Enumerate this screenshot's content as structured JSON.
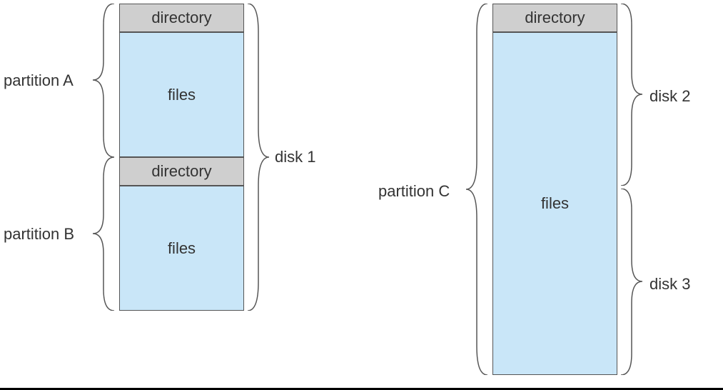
{
  "left": {
    "partA": {
      "label": "partition A",
      "dir": "directory",
      "files": "files"
    },
    "partB": {
      "label": "partition B",
      "dir": "directory",
      "files": "files"
    },
    "disk": "disk 1"
  },
  "right": {
    "partC": {
      "label": "partition C",
      "dir": "directory",
      "files": "files"
    },
    "disk2": "disk 2",
    "disk3": "disk 3"
  }
}
